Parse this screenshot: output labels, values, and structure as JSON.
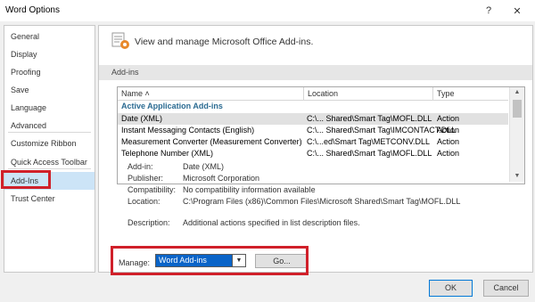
{
  "window": {
    "title": "Word Options",
    "help_glyph": "?",
    "close_glyph": "✕"
  },
  "sidebar": {
    "items": [
      {
        "label": "General"
      },
      {
        "label": "Display"
      },
      {
        "label": "Proofing"
      },
      {
        "label": "Save"
      },
      {
        "label": "Language"
      },
      {
        "label": "Advanced"
      },
      {
        "label": "Customize Ribbon"
      },
      {
        "label": "Quick Access Toolbar"
      },
      {
        "label": "Add-Ins"
      },
      {
        "label": "Trust Center"
      }
    ],
    "selected": "Add-Ins"
  },
  "header": {
    "text": "View and manage Microsoft Office Add-ins.",
    "icon": "gear-addins-icon"
  },
  "section": {
    "label": "Add-ins"
  },
  "table": {
    "columns": [
      "Name ˄",
      "Location",
      "Type"
    ],
    "group": "Active Application Add-ins",
    "rows": [
      {
        "name": "Date (XML)",
        "location": "C:\\... Shared\\Smart Tag\\MOFL.DLL",
        "type": "Action",
        "selected": true
      },
      {
        "name": "Instant Messaging Contacts (English)",
        "location": "C:\\... Shared\\Smart Tag\\IMCONTACT.DLL",
        "type": "Action"
      },
      {
        "name": "Measurement Converter (Measurement Converter)",
        "location": "C:\\...ed\\Smart Tag\\METCONV.DLL",
        "type": "Action"
      },
      {
        "name": "Telephone Number (XML)",
        "location": "C:\\... Shared\\Smart Tag\\MOFL.DLL",
        "type": "Action"
      }
    ]
  },
  "details": {
    "addin": {
      "label": "Add-in:",
      "value": "Date (XML)"
    },
    "publisher": {
      "label": "Publisher:",
      "value": "Microsoft Corporation"
    },
    "compatibility": {
      "label": "Compatibility:",
      "value": "No compatibility information available"
    },
    "location": {
      "label": "Location:",
      "value": "C:\\Program Files (x86)\\Common Files\\Microsoft Shared\\Smart Tag\\MOFL.DLL"
    },
    "description": {
      "label": "Description:",
      "value": "Additional actions specified in list description files."
    }
  },
  "manage": {
    "label": "Manage:",
    "selected": "Word Add-ins",
    "go_label": "Go..."
  },
  "footer": {
    "ok_label": "OK",
    "cancel_label": "Cancel"
  },
  "colors": {
    "accent": "#0a64c8",
    "highlight": "#d0202a",
    "selected_nav": "#cce4f7"
  }
}
